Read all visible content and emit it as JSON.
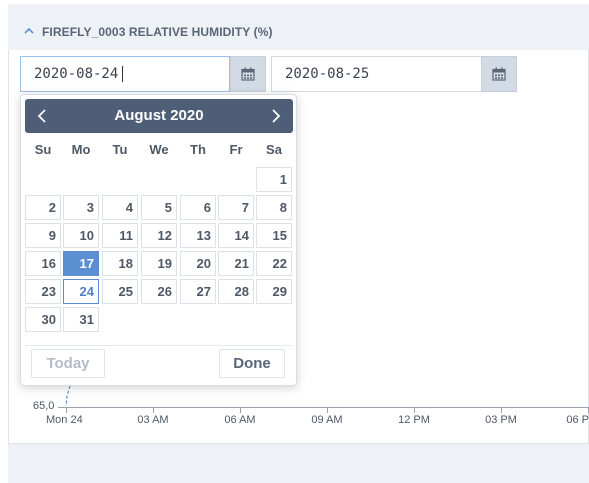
{
  "panel": {
    "title": "FIREFLY_0003 RELATIVE HUMIDITY (%)"
  },
  "date_range": {
    "start_value": "2020-08-24",
    "end_value": "2020-08-25"
  },
  "calendar": {
    "month_label": "August 2020",
    "weekdays": [
      "Su",
      "Mo",
      "Tu",
      "We",
      "Th",
      "Fr",
      "Sa"
    ],
    "selected_day": "17",
    "highlighted_day": "24",
    "weeks": [
      [
        "",
        "",
        "",
        "",
        "",
        "",
        "1"
      ],
      [
        "2",
        "3",
        "4",
        "5",
        "6",
        "7",
        "8"
      ],
      [
        "9",
        "10",
        "11",
        "12",
        "13",
        "14",
        "15"
      ],
      [
        "16",
        "17",
        "18",
        "19",
        "20",
        "21",
        "22"
      ],
      [
        "23",
        "24",
        "25",
        "26",
        "27",
        "28",
        "29"
      ],
      [
        "30",
        "31",
        "",
        "",
        "",
        "",
        ""
      ]
    ],
    "today_label": "Today",
    "done_label": "Done"
  },
  "chart": {
    "y_tick_label": "65,0",
    "x_tick_labels": [
      "Mon 24",
      "03 AM",
      "06 AM",
      "09 AM",
      "12 PM",
      "03 PM",
      "06 P"
    ],
    "series_color": "#5b8fd1"
  },
  "colors": {
    "accent": "#5b8fd1",
    "calendar_header": "#4e5e77"
  }
}
